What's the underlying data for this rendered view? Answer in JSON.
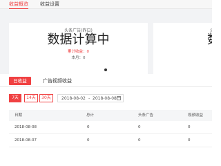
{
  "topbar": {
    "tabs": [
      {
        "label": "收益概览",
        "active": true
      },
      {
        "label": "收益设置",
        "active": false
      }
    ]
  },
  "carousel": {
    "main_card": {
      "subtitle": "头条广告(昨日)",
      "value": "数据计算中",
      "total_income": "累计收益：0",
      "month": "本月：0"
    },
    "peek_card": {
      "subtitle": "头条",
      "value": "数据"
    }
  },
  "income_tabs": {
    "daily": "日收益",
    "ad_video": "广告视频收益"
  },
  "filters": {
    "ranges": [
      "7天",
      "14天",
      "30天"
    ],
    "selected_range": "7天",
    "start_date": "2018-08-02",
    "separator": "-",
    "end_date": "2018-08-08"
  },
  "table": {
    "headers": [
      "日期",
      "总计",
      "头条广告",
      "视频收益"
    ],
    "rows": [
      [
        "2018-08-08",
        "0",
        "0",
        "0"
      ],
      [
        "2018-08-07",
        "0",
        "0",
        "0"
      ]
    ]
  },
  "colors": {
    "accent": "#f04142",
    "panel_bg": "#f2f3f5"
  }
}
